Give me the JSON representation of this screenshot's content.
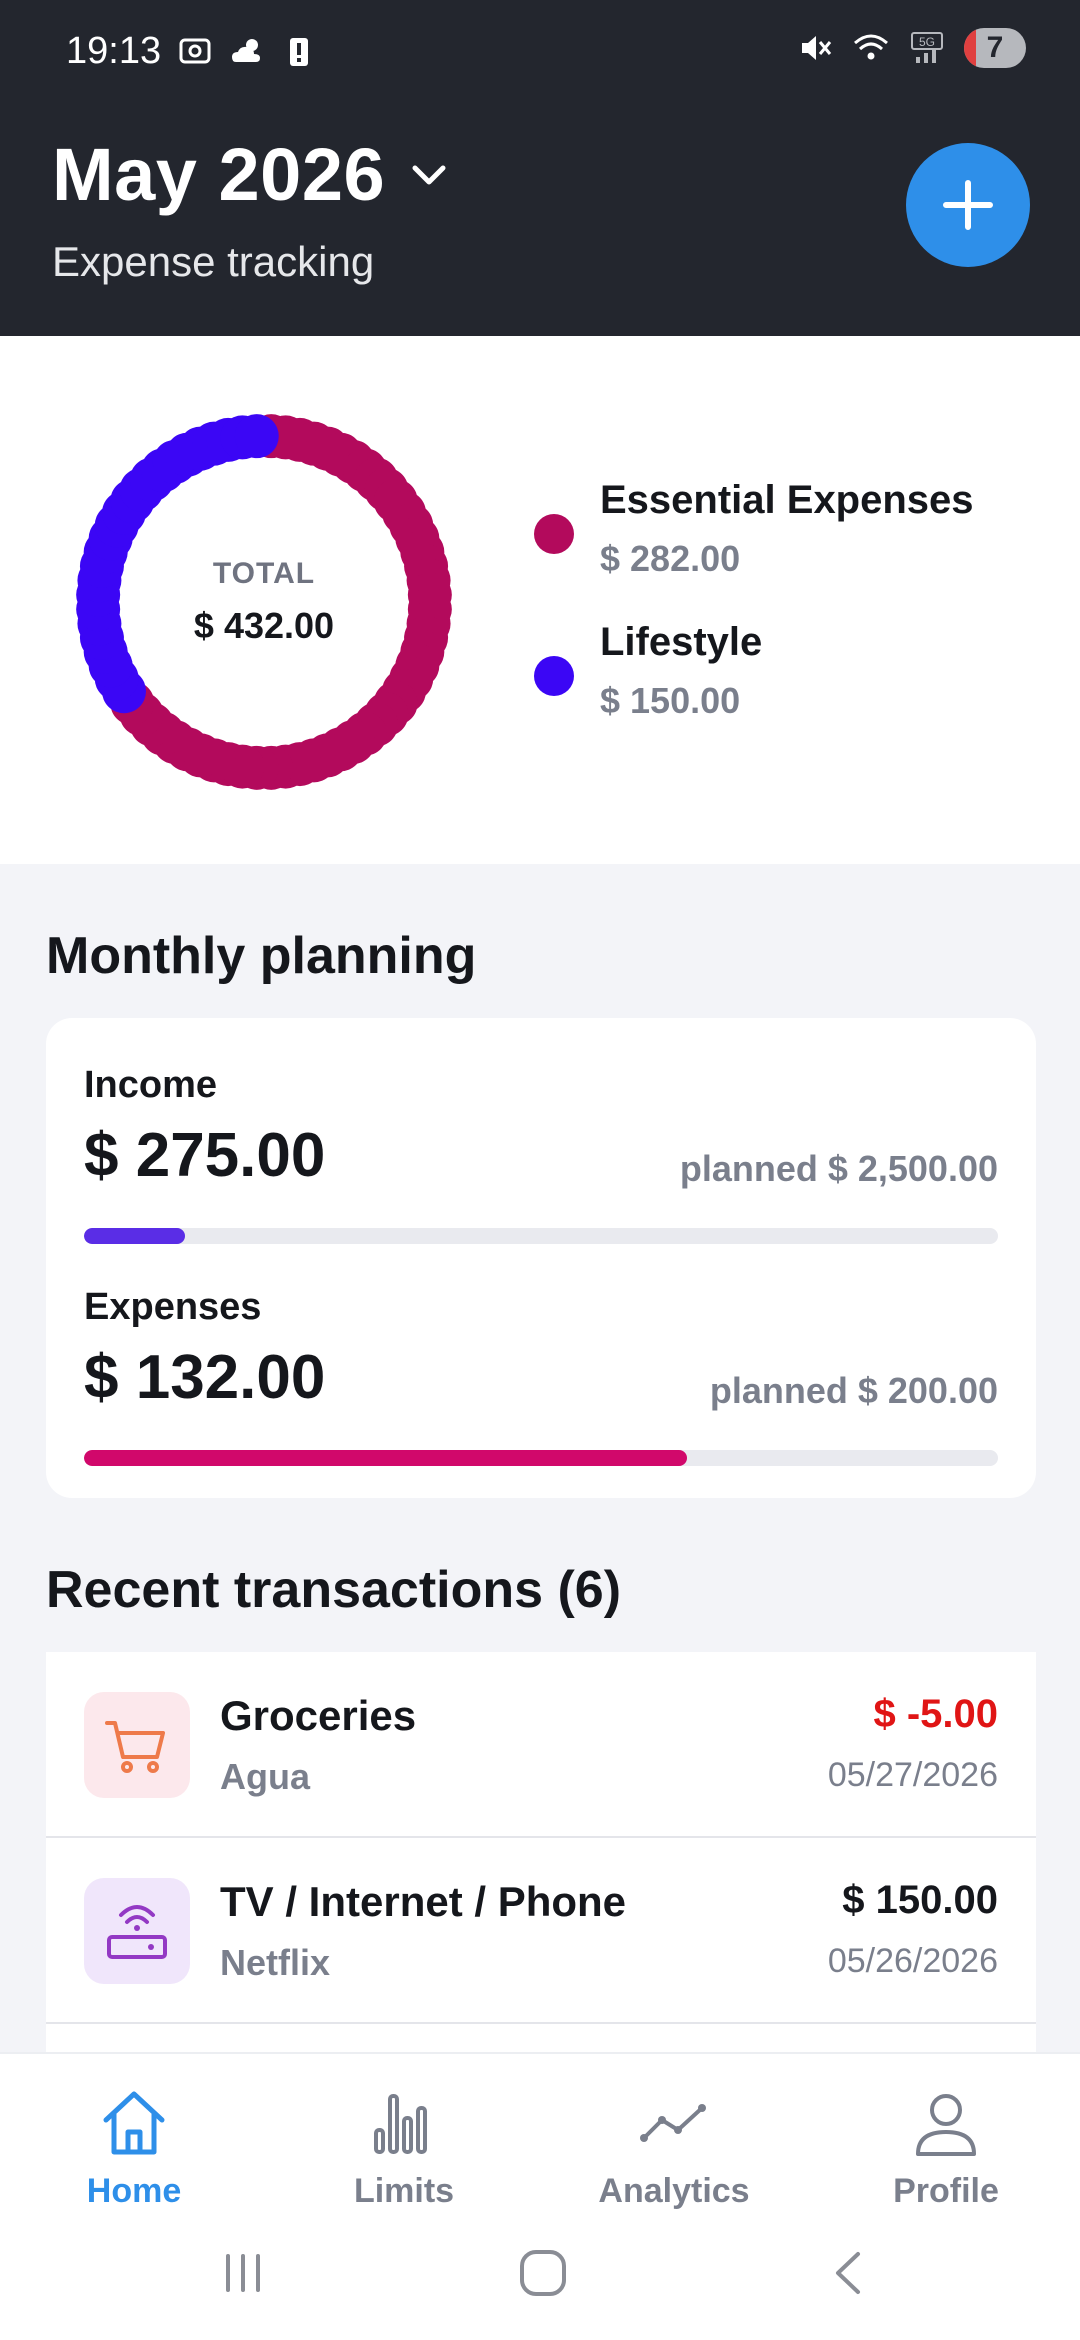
{
  "status_bar": {
    "time": "19:13",
    "battery": "7"
  },
  "header": {
    "month": "May 2026",
    "subtitle": "Expense tracking"
  },
  "summary": {
    "total_label": "TOTAL",
    "total_value": "$ 432.00",
    "categories": [
      {
        "name": "Essential Expenses",
        "value": "$ 282.00",
        "amount": 282,
        "color": "#b30a5c"
      },
      {
        "name": "Lifestyle",
        "value": "$ 150.00",
        "amount": 150,
        "color": "#3b06f5"
      }
    ]
  },
  "planning": {
    "title": "Monthly planning",
    "income": {
      "label": "Income",
      "amount": "$ 275.00",
      "planned": "planned $ 2,500.00",
      "progress": 0.11,
      "color": "#5a2de6"
    },
    "expenses": {
      "label": "Expenses",
      "amount": "$ 132.00",
      "planned": "planned $ 200.00",
      "progress": 0.66,
      "color": "#d1086b"
    }
  },
  "transactions": {
    "title": "Recent transactions (6)",
    "items": [
      {
        "name": "Groceries",
        "sub": "Agua",
        "amount": "$ -5.00",
        "date": "05/27/2026",
        "icon": "shopping-cart-icon",
        "amount_color": "#e01515"
      },
      {
        "name": "TV / Internet / Phone",
        "sub": "Netflix",
        "amount": "$ 150.00",
        "date": "05/26/2026",
        "icon": "router-icon",
        "amount_color": "#15171c"
      }
    ]
  },
  "nav": {
    "home": "Home",
    "limits": "Limits",
    "analytics": "Analytics",
    "profile": "Profile"
  },
  "colors": {
    "header_bg": "#23262e",
    "accent": "#2e8fe9",
    "nav_inactive": "#7a7f8c"
  }
}
